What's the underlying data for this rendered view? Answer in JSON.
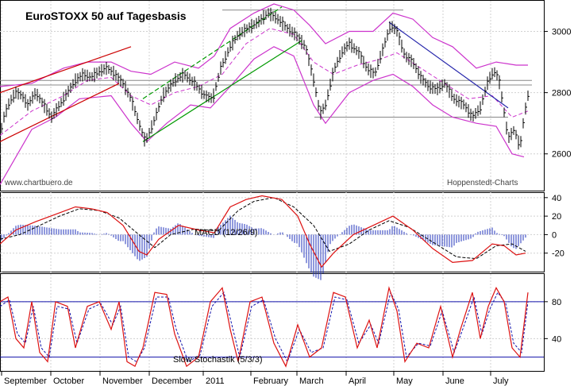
{
  "chart_data": [
    {
      "type": "candlestick",
      "title": "EuroSTOXX 50 auf Tagesbasis",
      "source_left": "www.chartbuero.de",
      "source_right": "Hoppenstedt-Charts",
      "ylim": [
        2480,
        3100
      ],
      "yticks": [
        2600,
        2800,
        3000
      ],
      "colors": {
        "price": "#000000",
        "bollinger": "#cc33cc",
        "ma": "#cc33cc",
        "trend_red": "#cc0000",
        "trend_green": "#009900",
        "trend_blue": "#2222aa",
        "support": "#888888"
      },
      "price_path": [
        [
          0,
          2660
        ],
        [
          5,
          2720
        ],
        [
          12,
          2770
        ],
        [
          20,
          2800
        ],
        [
          28,
          2790
        ],
        [
          35,
          2760
        ],
        [
          45,
          2800
        ],
        [
          55,
          2760
        ],
        [
          65,
          2720
        ],
        [
          75,
          2760
        ],
        [
          85,
          2800
        ],
        [
          95,
          2840
        ],
        [
          105,
          2860
        ],
        [
          115,
          2850
        ],
        [
          125,
          2870
        ],
        [
          135,
          2880
        ],
        [
          145,
          2860
        ],
        [
          155,
          2830
        ],
        [
          165,
          2780
        ],
        [
          175,
          2700
        ],
        [
          183,
          2640
        ],
        [
          193,
          2700
        ],
        [
          205,
          2790
        ],
        [
          220,
          2840
        ],
        [
          232,
          2860
        ],
        [
          245,
          2830
        ],
        [
          258,
          2790
        ],
        [
          268,
          2780
        ],
        [
          278,
          2880
        ],
        [
          290,
          2950
        ],
        [
          300,
          2990
        ],
        [
          312,
          3010
        ],
        [
          325,
          3030
        ],
        [
          338,
          3060
        ],
        [
          350,
          3040
        ],
        [
          362,
          3010
        ],
        [
          372,
          2990
        ],
        [
          385,
          2950
        ],
        [
          396,
          2830
        ],
        [
          403,
          2730
        ],
        [
          410,
          2760
        ],
        [
          420,
          2870
        ],
        [
          430,
          2930
        ],
        [
          440,
          2960
        ],
        [
          452,
          2930
        ],
        [
          462,
          2880
        ],
        [
          472,
          2860
        ],
        [
          482,
          2940
        ],
        [
          492,
          3020
        ],
        [
          500,
          3000
        ],
        [
          510,
          2920
        ],
        [
          520,
          2900
        ],
        [
          530,
          2850
        ],
        [
          540,
          2820
        ],
        [
          550,
          2810
        ],
        [
          560,
          2830
        ],
        [
          572,
          2780
        ],
        [
          585,
          2760
        ],
        [
          595,
          2720
        ],
        [
          605,
          2750
        ],
        [
          615,
          2840
        ],
        [
          622,
          2870
        ],
        [
          628,
          2850
        ],
        [
          633,
          2770
        ],
        [
          640,
          2650
        ],
        [
          648,
          2680
        ],
        [
          655,
          2620
        ],
        [
          660,
          2720
        ],
        [
          665,
          2790
        ]
      ],
      "bollinger_upper": [
        [
          0,
          2820
        ],
        [
          40,
          2830
        ],
        [
          80,
          2880
        ],
        [
          110,
          2900
        ],
        [
          140,
          2900
        ],
        [
          165,
          2870
        ],
        [
          190,
          2860
        ],
        [
          220,
          2900
        ],
        [
          250,
          2880
        ],
        [
          270,
          2920
        ],
        [
          290,
          3010
        ],
        [
          320,
          3060
        ],
        [
          345,
          3090
        ],
        [
          370,
          3070
        ],
        [
          390,
          3020
        ],
        [
          410,
          2960
        ],
        [
          440,
          3000
        ],
        [
          470,
          3000
        ],
        [
          495,
          3060
        ],
        [
          520,
          3040
        ],
        [
          545,
          2980
        ],
        [
          570,
          2950
        ],
        [
          600,
          2880
        ],
        [
          625,
          2900
        ],
        [
          650,
          2890
        ],
        [
          665,
          2890
        ]
      ],
      "bollinger_lower": [
        [
          0,
          2500
        ],
        [
          40,
          2680
        ],
        [
          70,
          2720
        ],
        [
          100,
          2780
        ],
        [
          140,
          2790
        ],
        [
          165,
          2700
        ],
        [
          185,
          2640
        ],
        [
          210,
          2700
        ],
        [
          240,
          2760
        ],
        [
          265,
          2750
        ],
        [
          290,
          2820
        ],
        [
          320,
          2910
        ],
        [
          345,
          2950
        ],
        [
          370,
          2920
        ],
        [
          395,
          2760
        ],
        [
          410,
          2700
        ],
        [
          440,
          2800
        ],
        [
          470,
          2840
        ],
        [
          495,
          2860
        ],
        [
          520,
          2820
        ],
        [
          545,
          2760
        ],
        [
          570,
          2720
        ],
        [
          600,
          2700
        ],
        [
          625,
          2690
        ],
        [
          645,
          2600
        ],
        [
          660,
          2590
        ]
      ],
      "moving_average": [
        [
          0,
          2660
        ],
        [
          40,
          2740
        ],
        [
          80,
          2790
        ],
        [
          110,
          2840
        ],
        [
          140,
          2850
        ],
        [
          165,
          2790
        ],
        [
          190,
          2760
        ],
        [
          220,
          2800
        ],
        [
          250,
          2820
        ],
        [
          280,
          2860
        ],
        [
          310,
          2960
        ],
        [
          340,
          3010
        ],
        [
          370,
          2990
        ],
        [
          395,
          2900
        ],
        [
          420,
          2860
        ],
        [
          450,
          2890
        ],
        [
          480,
          2910
        ],
        [
          500,
          2930
        ],
        [
          530,
          2880
        ],
        [
          560,
          2830
        ],
        [
          590,
          2780
        ],
        [
          620,
          2790
        ],
        [
          645,
          2720
        ],
        [
          665,
          2740
        ]
      ]
    },
    {
      "type": "macd",
      "label": "MACD (12/26/9)",
      "ylim": [
        -40,
        45
      ],
      "yticks": [
        -20,
        0,
        20,
        40
      ],
      "macd_path": [
        [
          0,
          -10
        ],
        [
          20,
          5
        ],
        [
          45,
          14
        ],
        [
          70,
          22
        ],
        [
          95,
          30
        ],
        [
          115,
          28
        ],
        [
          135,
          24
        ],
        [
          155,
          10
        ],
        [
          175,
          -18
        ],
        [
          185,
          -22
        ],
        [
          200,
          -5
        ],
        [
          225,
          10
        ],
        [
          250,
          5
        ],
        [
          270,
          2
        ],
        [
          290,
          30
        ],
        [
          310,
          38
        ],
        [
          330,
          42
        ],
        [
          355,
          38
        ],
        [
          375,
          20
        ],
        [
          390,
          -10
        ],
        [
          405,
          -35
        ],
        [
          420,
          -20
        ],
        [
          445,
          0
        ],
        [
          470,
          10
        ],
        [
          495,
          20
        ],
        [
          520,
          5
        ],
        [
          545,
          -15
        ],
        [
          570,
          -30
        ],
        [
          595,
          -28
        ],
        [
          620,
          -10
        ],
        [
          635,
          -12
        ],
        [
          650,
          -22
        ],
        [
          662,
          -20
        ]
      ],
      "signal_path": [
        [
          0,
          -5
        ],
        [
          25,
          0
        ],
        [
          50,
          10
        ],
        [
          75,
          20
        ],
        [
          100,
          28
        ],
        [
          125,
          26
        ],
        [
          150,
          18
        ],
        [
          175,
          0
        ],
        [
          195,
          -14
        ],
        [
          215,
          0
        ],
        [
          245,
          6
        ],
        [
          275,
          4
        ],
        [
          300,
          26
        ],
        [
          320,
          36
        ],
        [
          345,
          40
        ],
        [
          370,
          30
        ],
        [
          395,
          10
        ],
        [
          415,
          -18
        ],
        [
          440,
          -10
        ],
        [
          465,
          5
        ],
        [
          490,
          15
        ],
        [
          515,
          8
        ],
        [
          545,
          -8
        ],
        [
          575,
          -24
        ],
        [
          600,
          -26
        ],
        [
          625,
          -12
        ],
        [
          645,
          -10
        ],
        [
          662,
          -18
        ]
      ]
    },
    {
      "type": "stochastic",
      "label": "Slow Stochastik (5/3/3)",
      "ylim": [
        5,
        110
      ],
      "yticks": [
        40,
        80
      ],
      "levels": [
        80,
        20
      ],
      "k_path": [
        [
          0,
          80
        ],
        [
          10,
          85
        ],
        [
          20,
          40
        ],
        [
          30,
          30
        ],
        [
          40,
          80
        ],
        [
          50,
          25
        ],
        [
          60,
          15
        ],
        [
          70,
          80
        ],
        [
          85,
          75
        ],
        [
          95,
          30
        ],
        [
          110,
          75
        ],
        [
          125,
          80
        ],
        [
          140,
          50
        ],
        [
          150,
          80
        ],
        [
          160,
          15
        ],
        [
          170,
          10
        ],
        [
          180,
          30
        ],
        [
          195,
          90
        ],
        [
          210,
          88
        ],
        [
          220,
          45
        ],
        [
          235,
          10
        ],
        [
          250,
          20
        ],
        [
          265,
          80
        ],
        [
          280,
          95
        ],
        [
          290,
          50
        ],
        [
          300,
          15
        ],
        [
          315,
          80
        ],
        [
          330,
          85
        ],
        [
          345,
          35
        ],
        [
          360,
          10
        ],
        [
          375,
          55
        ],
        [
          390,
          20
        ],
        [
          405,
          30
        ],
        [
          420,
          90
        ],
        [
          435,
          85
        ],
        [
          450,
          30
        ],
        [
          465,
          60
        ],
        [
          475,
          30
        ],
        [
          490,
          95
        ],
        [
          500,
          70
        ],
        [
          510,
          15
        ],
        [
          525,
          35
        ],
        [
          540,
          30
        ],
        [
          555,
          75
        ],
        [
          570,
          20
        ],
        [
          580,
          50
        ],
        [
          595,
          90
        ],
        [
          605,
          40
        ],
        [
          615,
          75
        ],
        [
          625,
          95
        ],
        [
          635,
          80
        ],
        [
          645,
          30
        ],
        [
          655,
          20
        ],
        [
          665,
          90
        ]
      ],
      "d_path": [
        [
          0,
          75
        ],
        [
          12,
          82
        ],
        [
          22,
          45
        ],
        [
          32,
          35
        ],
        [
          42,
          75
        ],
        [
          52,
          30
        ],
        [
          62,
          20
        ],
        [
          72,
          75
        ],
        [
          87,
          72
        ],
        [
          97,
          35
        ],
        [
          112,
          72
        ],
        [
          127,
          78
        ],
        [
          142,
          55
        ],
        [
          152,
          75
        ],
        [
          162,
          20
        ],
        [
          172,
          15
        ],
        [
          182,
          30
        ],
        [
          197,
          85
        ],
        [
          212,
          85
        ],
        [
          222,
          50
        ],
        [
          237,
          15
        ],
        [
          252,
          22
        ],
        [
          267,
          75
        ],
        [
          282,
          90
        ],
        [
          292,
          55
        ],
        [
          302,
          20
        ],
        [
          317,
          75
        ],
        [
          332,
          82
        ],
        [
          347,
          40
        ],
        [
          362,
          15
        ],
        [
          377,
          50
        ],
        [
          392,
          25
        ],
        [
          407,
          30
        ],
        [
          422,
          85
        ],
        [
          437,
          82
        ],
        [
          452,
          35
        ],
        [
          467,
          55
        ],
        [
          477,
          35
        ],
        [
          492,
          90
        ],
        [
          502,
          72
        ],
        [
          512,
          20
        ],
        [
          527,
          35
        ],
        [
          542,
          32
        ],
        [
          557,
          70
        ],
        [
          572,
          25
        ],
        [
          582,
          48
        ],
        [
          597,
          85
        ],
        [
          607,
          45
        ],
        [
          617,
          72
        ],
        [
          627,
          90
        ],
        [
          637,
          78
        ],
        [
          647,
          35
        ],
        [
          657,
          25
        ],
        [
          665,
          80
        ]
      ]
    }
  ],
  "x_axis": {
    "months": [
      "September",
      "October",
      "November",
      "December",
      "2011",
      "February",
      "March",
      "April",
      "May",
      "June",
      "July"
    ]
  }
}
